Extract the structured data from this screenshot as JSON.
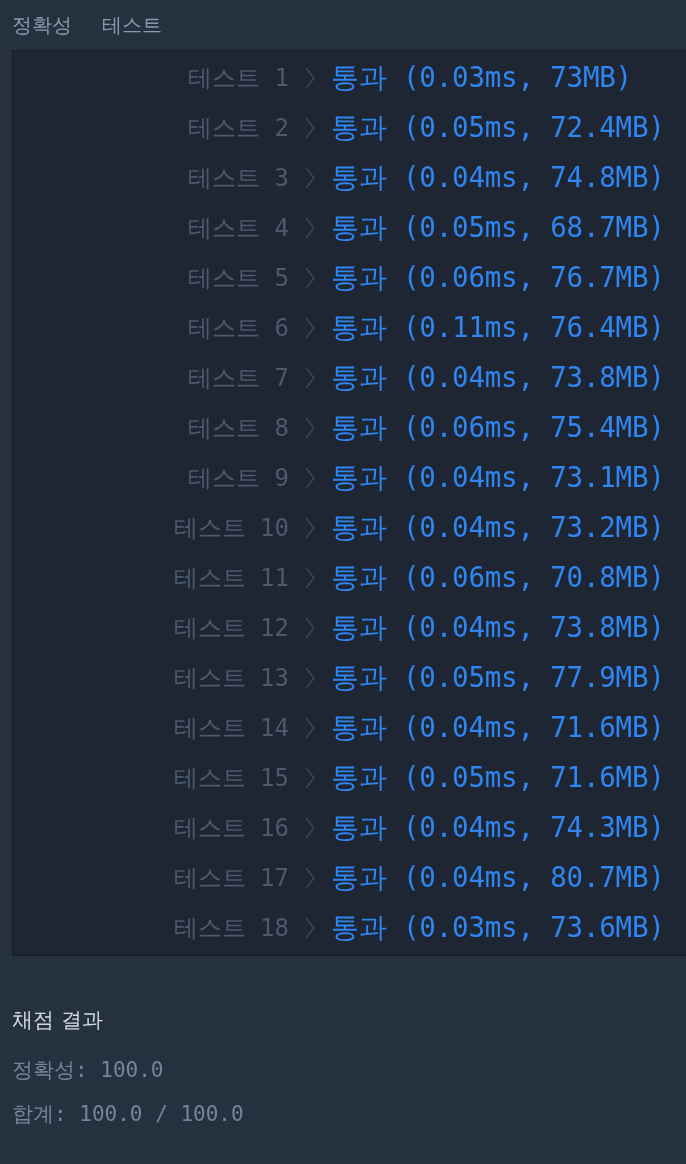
{
  "header": {
    "title": "정확성",
    "subtitle": "테스트"
  },
  "tests": [
    {
      "label": "테스트 1",
      "kind": "pass",
      "result": "통과 (0.03ms, 73MB)"
    },
    {
      "label": "테스트 2",
      "kind": "pass",
      "result": "통과 (0.05ms, 72.4MB)"
    },
    {
      "label": "테스트 3",
      "kind": "pass",
      "result": "통과 (0.04ms, 74.8MB)"
    },
    {
      "label": "테스트 4",
      "kind": "pass",
      "result": "통과 (0.05ms, 68.7MB)"
    },
    {
      "label": "테스트 5",
      "kind": "pass",
      "result": "통과 (0.06ms, 76.7MB)"
    },
    {
      "label": "테스트 6",
      "kind": "pass",
      "result": "통과 (0.11ms, 76.4MB)"
    },
    {
      "label": "테스트 7",
      "kind": "pass",
      "result": "통과 (0.04ms, 73.8MB)"
    },
    {
      "label": "테스트 8",
      "kind": "pass",
      "result": "통과 (0.06ms, 75.4MB)"
    },
    {
      "label": "테스트 9",
      "kind": "pass",
      "result": "통과 (0.04ms, 73.1MB)"
    },
    {
      "label": "테스트 10",
      "kind": "pass",
      "result": "통과 (0.04ms, 73.2MB)"
    },
    {
      "label": "테스트 11",
      "kind": "pass",
      "result": "통과 (0.06ms, 70.8MB)"
    },
    {
      "label": "테스트 12",
      "kind": "pass",
      "result": "통과 (0.04ms, 73.8MB)"
    },
    {
      "label": "테스트 13",
      "kind": "pass",
      "result": "통과 (0.05ms, 77.9MB)"
    },
    {
      "label": "테스트 14",
      "kind": "pass",
      "result": "통과 (0.04ms, 71.6MB)"
    },
    {
      "label": "테스트 15",
      "kind": "pass",
      "result": "통과 (0.05ms, 71.6MB)"
    },
    {
      "label": "테스트 16",
      "kind": "pass",
      "result": "통과 (0.04ms, 74.3MB)"
    },
    {
      "label": "테스트 17",
      "kind": "pass",
      "result": "통과 (0.04ms, 80.7MB)"
    },
    {
      "label": "테스트 18",
      "kind": "pass",
      "result": "통과 (0.03ms, 73.6MB)"
    }
  ],
  "summary": {
    "title": "채점 결과",
    "lines": [
      "정확성: 100.0",
      "합계: 100.0 / 100.0"
    ]
  }
}
